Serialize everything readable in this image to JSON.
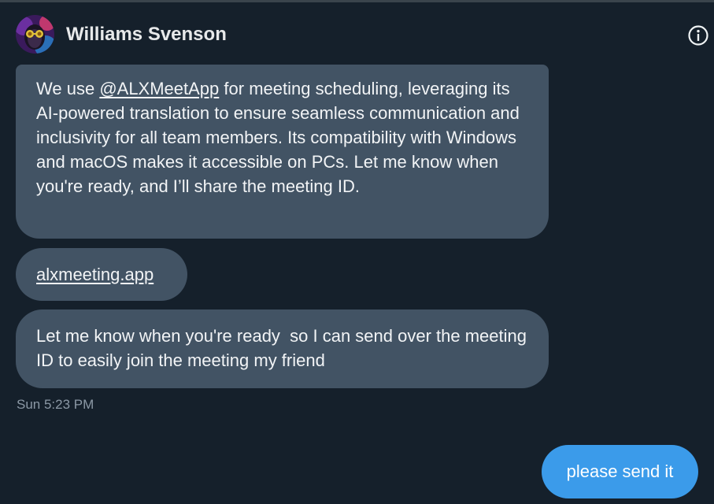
{
  "header": {
    "contact_name": "Williams Svenson",
    "avatar_icon": "avatar-image",
    "info_icon": "info-icon"
  },
  "messages": [
    {
      "direction": "received",
      "text_before": "We use ",
      "mention": "@ALXMeetApp",
      "text_after": " for meeting scheduling, leveraging its AI-powered translation to ensure seamless communication and inclusivity for all team members. Its compatibility with Windows and macOS makes it accessible on PCs. Let me know when you're ready, and I’ll share the meeting ID."
    },
    {
      "direction": "received",
      "link": "alxmeeting.app"
    },
    {
      "direction": "received",
      "text": "Let me know when you're ready  so I can send over the meeting ID to easily join the meeting my friend"
    }
  ],
  "timestamp": "Sun 5:23 PM",
  "sent_message": {
    "direction": "sent",
    "text": "please send it"
  },
  "colors": {
    "background": "#15202b",
    "received_bubble": "#425364",
    "sent_bubble": "#3b9bea",
    "timestamp": "#8b98a5"
  }
}
